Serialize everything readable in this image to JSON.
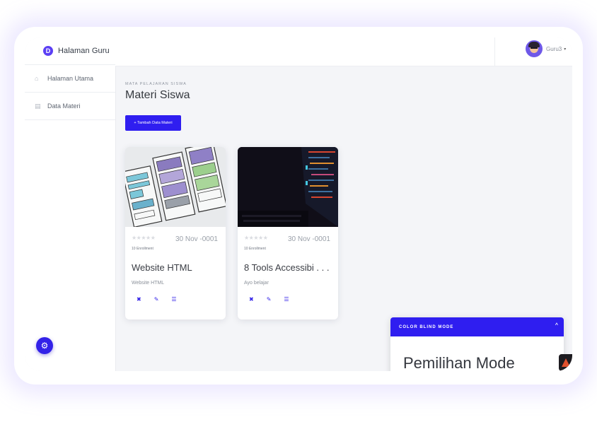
{
  "sidebar": {
    "brand_logo": "D",
    "brand": "Halaman Guru",
    "items": [
      {
        "label": "Halaman Utama",
        "icon": "home-icon"
      },
      {
        "label": "Data Materi",
        "icon": "book-icon"
      }
    ],
    "settings_icon": "gear-icon"
  },
  "topbar": {
    "user_name": "Guru3",
    "caret": "▾"
  },
  "main": {
    "breadcrumb": "MATA PELAJARAN SISWA",
    "title": "Materi Siswa",
    "add_button": "+ Tambah Data Materi",
    "cards": [
      {
        "stars": "★★★★★",
        "date": "30 Nov -0001",
        "enrollment": "10 Enrollment",
        "title": "Website HTML",
        "description": "Website HTML",
        "actions": {
          "delete": "✖",
          "edit": "✎",
          "list": "☰"
        }
      },
      {
        "stars": "★★★★★",
        "date": "30 Nov -0001",
        "enrollment": "10 Enrollment",
        "title": "8 Tools Accessibi . . .",
        "description": "Ayo belajar",
        "actions": {
          "delete": "✖",
          "edit": "✎",
          "list": "☰"
        }
      }
    ]
  },
  "color_blind_panel": {
    "header": "COLOR BLIND MODE",
    "chevron": "^",
    "title": "Pemilihan Mode"
  },
  "colors": {
    "accent": "#2f1ef0",
    "background": "#f4f5f8"
  }
}
